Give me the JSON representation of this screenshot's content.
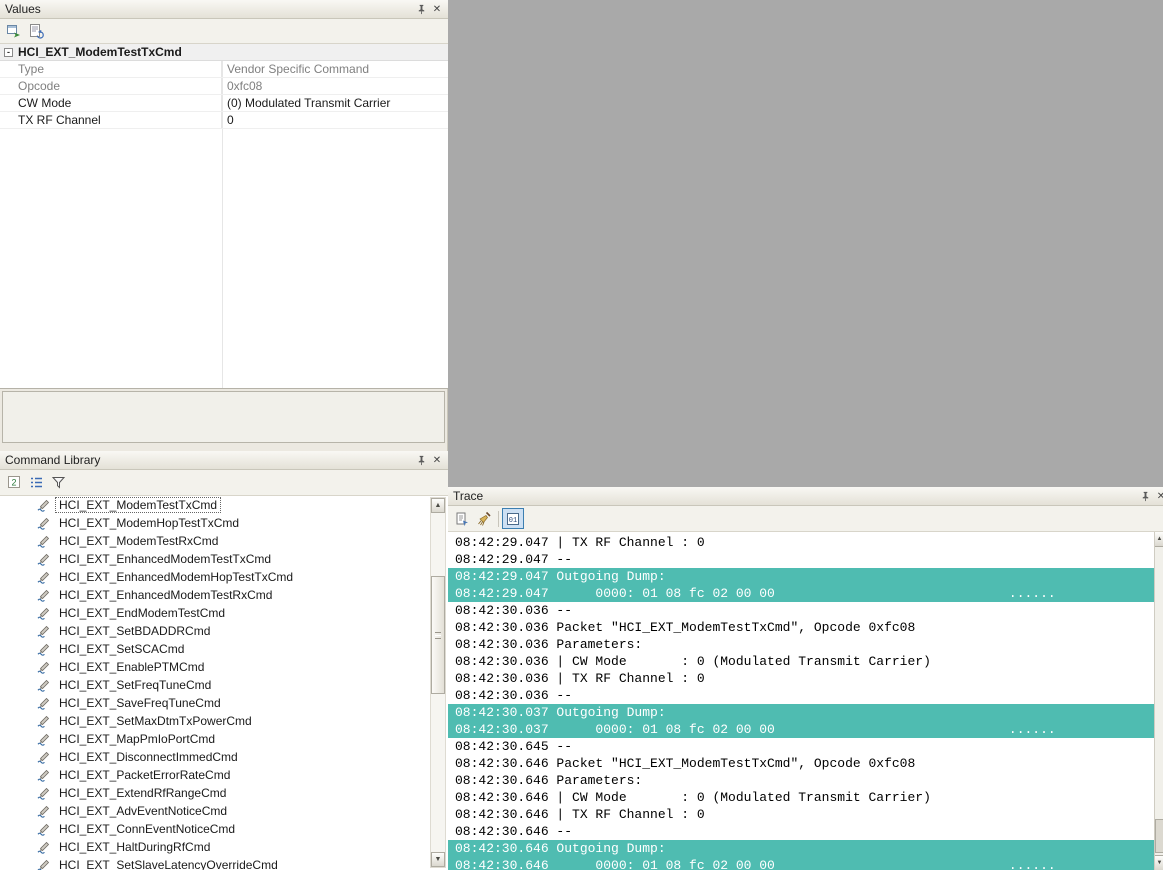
{
  "colors": {
    "highlight": "#4fbcb1",
    "mdi_background": "#a9a9a9"
  },
  "glyphs": {
    "close": "✕",
    "collapse_expanded": "-",
    "scroll_up": "▲",
    "scroll_down": "▼"
  },
  "values_panel": {
    "title": "Values",
    "toolbar_icons": [
      "send-command",
      "reset-values"
    ],
    "header": "HCI_EXT_ModemTestTxCmd",
    "rows": [
      {
        "label": "Type",
        "value": "Vendor Specific Command",
        "readonly": true
      },
      {
        "label": "Opcode",
        "value": "0xfc08",
        "readonly": true
      },
      {
        "label": "CW Mode",
        "value": "(0) Modulated Transmit Carrier",
        "readonly": false
      },
      {
        "label": "TX RF Channel",
        "value": "0",
        "readonly": false
      }
    ]
  },
  "command_library": {
    "title": "Command Library",
    "toolbar_icons": [
      "sort-mode",
      "list-view",
      "filter"
    ],
    "selected_index": 0,
    "items": [
      "HCI_EXT_ModemTestTxCmd",
      "HCI_EXT_ModemHopTestTxCmd",
      "HCI_EXT_ModemTestRxCmd",
      "HCI_EXT_EnhancedModemTestTxCmd",
      "HCI_EXT_EnhancedModemHopTestTxCmd",
      "HCI_EXT_EnhancedModemTestRxCmd",
      "HCI_EXT_EndModemTestCmd",
      "HCI_EXT_SetBDADDRCmd",
      "HCI_EXT_SetSCACmd",
      "HCI_EXT_EnablePTMCmd",
      "HCI_EXT_SetFreqTuneCmd",
      "HCI_EXT_SaveFreqTuneCmd",
      "HCI_EXT_SetMaxDtmTxPowerCmd",
      "HCI_EXT_MapPmIoPortCmd",
      "HCI_EXT_DisconnectImmedCmd",
      "HCI_EXT_PacketErrorRateCmd",
      "HCI_EXT_ExtendRfRangeCmd",
      "HCI_EXT_AdvEventNoticeCmd",
      "HCI_EXT_ConnEventNoticeCmd",
      "HCI_EXT_HaltDuringRfCmd",
      "HCI_EXT_SetSlaveLatencyOverrideCmd"
    ]
  },
  "trace": {
    "title": "Trace",
    "toolbar_icons": [
      "copy-trace",
      "clear-trace",
      "hex-dump-toggle"
    ],
    "hex_dump_pressed": true,
    "lines": [
      {
        "text": "08:42:29.047 | TX RF Channel : 0",
        "highlight": false
      },
      {
        "text": "08:42:29.047 --",
        "highlight": false
      },
      {
        "text": "08:42:29.047 Outgoing Dump:",
        "highlight": true
      },
      {
        "text": "08:42:29.047      0000: 01 08 fc 02 00 00                              ......",
        "highlight": true
      },
      {
        "text": "08:42:30.036 --",
        "highlight": false
      },
      {
        "text": "08:42:30.036 Packet \"HCI_EXT_ModemTestTxCmd\", Opcode 0xfc08",
        "highlight": false
      },
      {
        "text": "08:42:30.036 Parameters:",
        "highlight": false
      },
      {
        "text": "08:42:30.036 | CW Mode       : 0 (Modulated Transmit Carrier)",
        "highlight": false
      },
      {
        "text": "08:42:30.036 | TX RF Channel : 0",
        "highlight": false
      },
      {
        "text": "08:42:30.036 --",
        "highlight": false
      },
      {
        "text": "08:42:30.037 Outgoing Dump:",
        "highlight": true
      },
      {
        "text": "08:42:30.037      0000: 01 08 fc 02 00 00                              ......",
        "highlight": true
      },
      {
        "text": "08:42:30.645 --",
        "highlight": false
      },
      {
        "text": "08:42:30.646 Packet \"HCI_EXT_ModemTestTxCmd\", Opcode 0xfc08",
        "highlight": false
      },
      {
        "text": "08:42:30.646 Parameters:",
        "highlight": false
      },
      {
        "text": "08:42:30.646 | CW Mode       : 0 (Modulated Transmit Carrier)",
        "highlight": false
      },
      {
        "text": "08:42:30.646 | TX RF Channel : 0",
        "highlight": false
      },
      {
        "text": "08:42:30.646 --",
        "highlight": false
      },
      {
        "text": "08:42:30.646 Outgoing Dump:",
        "highlight": true
      },
      {
        "text": "08:42:30.646      0000: 01 08 fc 02 00 00                              ......",
        "highlight": true
      }
    ]
  }
}
